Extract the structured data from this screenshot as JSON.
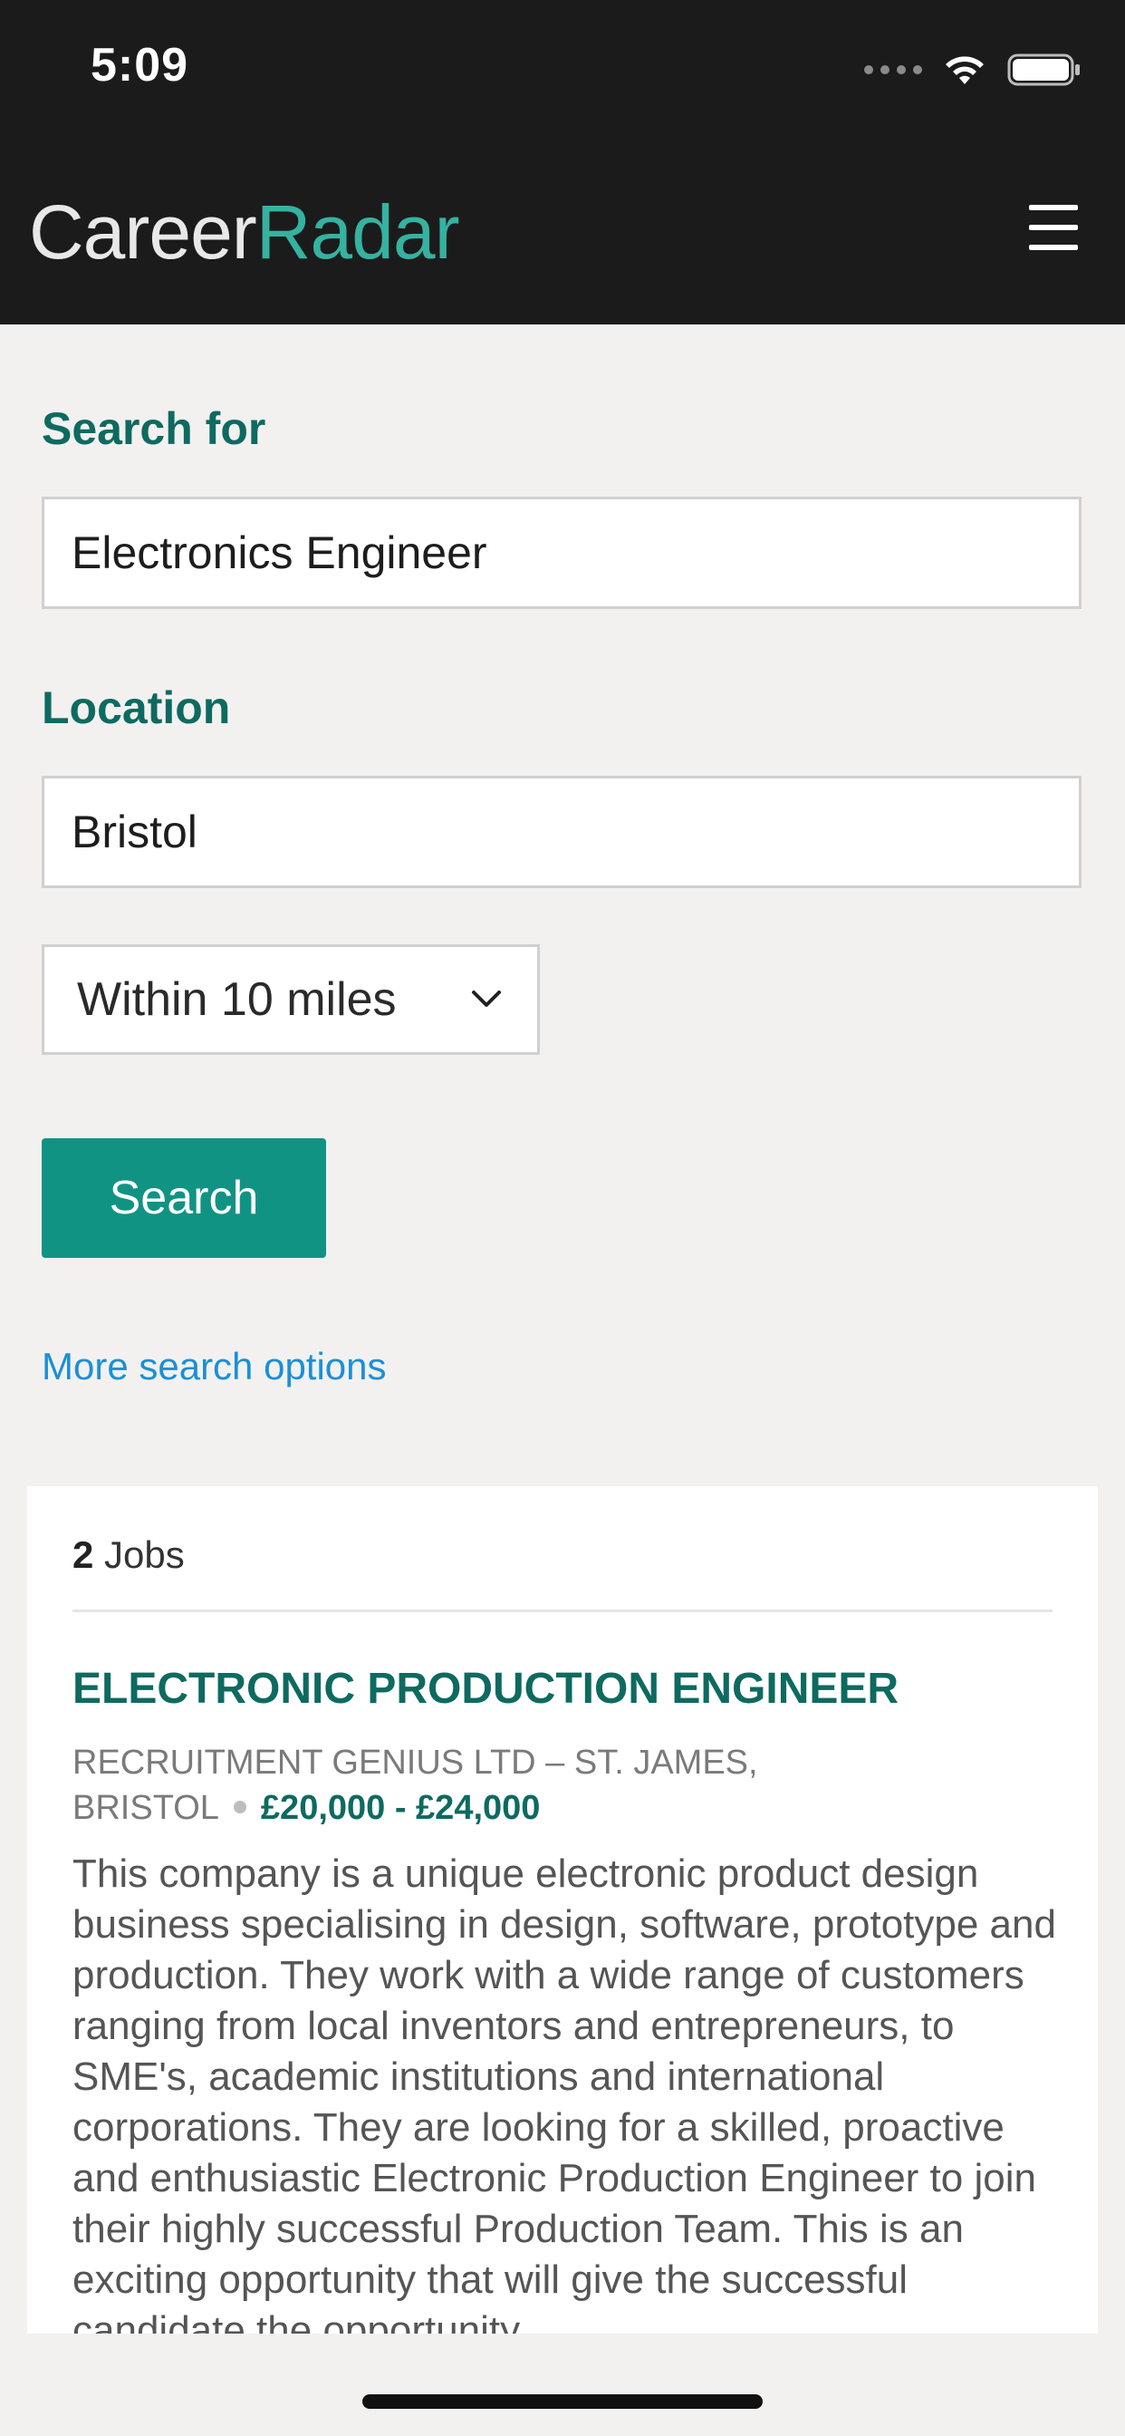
{
  "status_bar": {
    "time": "5:09"
  },
  "header": {
    "logo_part1": "Career",
    "logo_part2": "Radar"
  },
  "search": {
    "search_label": "Search for",
    "search_value": "Electronics Engineer",
    "location_label": "Location",
    "location_value": "Bristol",
    "distance_selected": "Within 10 miles",
    "search_button": "Search",
    "more_options": "More search options"
  },
  "results": {
    "count": "2",
    "count_label": "Jobs",
    "job": {
      "title": "ELECTRONIC PRODUCTION ENGINEER",
      "company_line1": "RECRUITMENT GENIUS LTD – ST. JAMES,",
      "company_line2": "BRISTOL",
      "salary": "£20,000 - £24,000",
      "description": "This company is a unique electronic product design business specialising in design, software, prototype and production. They work with a wide range of customers ranging from local inventors and entrepreneurs, to SME's, academic institutions and international corporations. They are looking for a skilled, proactive and enthusiastic Electronic Production Engineer to join their highly successful Production Team. This is an exciting opportunity that will give the successful candidate the opportunity"
    }
  }
}
